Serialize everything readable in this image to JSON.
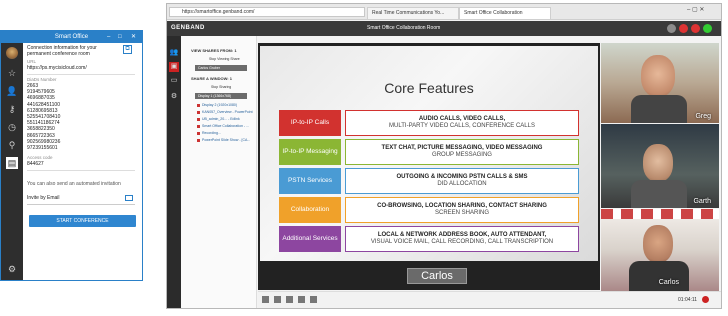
{
  "smart_office": {
    "title": "Smart Office",
    "window_controls": [
      "–",
      "□",
      "✕"
    ],
    "info_heading": "Connection information for your permanent conference room",
    "url_label": "URL",
    "url_value": "https://ps.mycisicloud.com/",
    "dialin_label": "DiaDs Number",
    "numbers": [
      "2663",
      "9194579605",
      "4696887035",
      "441628451100",
      "61280695813",
      "525541708410",
      "551141186274",
      "3658822350",
      "8665722363",
      "902569980236",
      "97239155601"
    ],
    "access_label": "Access code",
    "access_code": "844627",
    "invite_text": "You can also send an automated invitation",
    "invite_by_email": "Invite by Email",
    "start_button": "START CONFERENCE",
    "rail_icons": [
      "avatar",
      "star-icon",
      "user-icon",
      "lock-icon",
      "clock-icon",
      "pin-icon",
      "doc-icon",
      "gear-icon"
    ]
  },
  "browser": {
    "url": "https://smartoffice.genband.com/",
    "tabs": [
      "Real Time Communications Yo...",
      "Smart Office Collaboration"
    ],
    "app_title": "Smart Office Collaboration Room",
    "logo": "GENBAND",
    "panel": {
      "view_shares_title": "VIEW SHARES FROM: 1",
      "stop_viewing_label": "Stop Viewing Share",
      "current_share": "Carlos Gruber",
      "share_window_title": "SHARE A WINDOW: 1",
      "stop_sharing_label": "Stop Sharing",
      "display_items": [
        "Display 1 (1366x768)",
        "Display 2 (1920x1080)"
      ],
      "file_items": [
        "KAN057_Overview - PowerPoint",
        "UB_admin_20... - Edlink",
        "Smart Office Collaboration - ...",
        "Recording...",
        "PowerPoint Slide Show - [CA..."
      ]
    },
    "timer": "01:04:11"
  },
  "slide": {
    "title": "Core Features",
    "presenter_label": "Carlos",
    "rows": [
      {
        "label": "IP-to-IP Calls",
        "color": "#d2322f",
        "line1": "AUDIO CALLS, VIDEO CALLS,",
        "line2": "MULTI-PARTY VIDEO CALLS, CONFERENCE CALLS"
      },
      {
        "label": "IP-to-IP Messaging",
        "color": "#8bb634",
        "line1": "TEXT CHAT, PICTURE MESSAGING, VIDEO MESSAGING",
        "line2": "GROUP MESSAGING"
      },
      {
        "label": "PSTN Services",
        "color": "#4a9bd4",
        "line1": "OUTGOING & INCOMING PSTN CALLS & SMS",
        "line2": "DID ALLOCATION"
      },
      {
        "label": "Collaboration",
        "color": "#f0a12a",
        "line1": "CO-BROWSING, LOCATION SHARING, CONTACT SHARING",
        "line2": "SCREEN SHARING"
      },
      {
        "label": "Additional Services",
        "color": "#8d46a0",
        "line1": "LOCAL & NETWORK ADDRESS BOOK, AUTO ATTENDANT,",
        "line2": "VISUAL VOICE MAIL, CALL RECORDING, CALL TRANSCRIPTION"
      }
    ]
  },
  "videos": [
    {
      "name": "Greg"
    },
    {
      "name": "Garth"
    },
    {
      "name": "Carlos"
    }
  ]
}
